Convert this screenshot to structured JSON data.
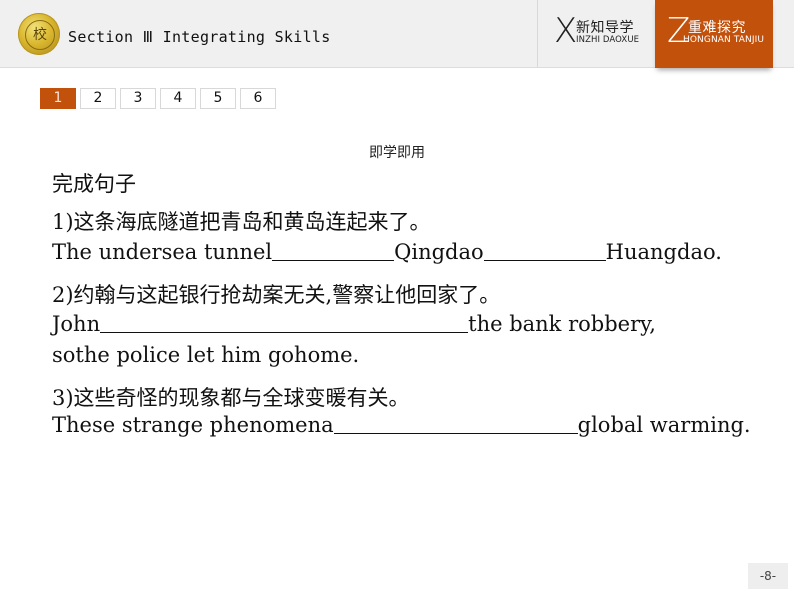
{
  "header": {
    "title": "Section Ⅲ  Integrating Skills",
    "logo_glyph": "校",
    "nav": [
      {
        "letter": "X",
        "cn": "新知导学",
        "en": "INZHI DAOXUE",
        "active": false
      },
      {
        "letter": "Z",
        "cn": "重难探究",
        "en": "HONGNAN TANJIU",
        "active": true
      }
    ]
  },
  "colors": {
    "accent": "#c2510c",
    "header_bg": "#f0f0f0"
  },
  "pager": {
    "pages": [
      "1",
      "2",
      "3",
      "4",
      "5",
      "6"
    ],
    "active_index": 0
  },
  "content": {
    "subtitle": "即学即用",
    "heading": "完成句子",
    "items": [
      {
        "cn": "1)这条海底隧道把青岛和黄岛连起来了。",
        "en_parts": [
          "The undersea tunnel",
          "Qingdao",
          "Huangdao."
        ]
      },
      {
        "cn": "2)约翰与这起银行抢劫案无关,警察让他回家了。",
        "en_parts": [
          "John",
          "the bank robbery,"
        ],
        "en_line2": "sothe police let him gohome."
      },
      {
        "cn": "3)这些奇怪的现象都与全球变暖有关。",
        "en_parts": [
          "These strange phenomena",
          "global warming."
        ]
      }
    ]
  },
  "footer": {
    "page_number": "-8-"
  }
}
